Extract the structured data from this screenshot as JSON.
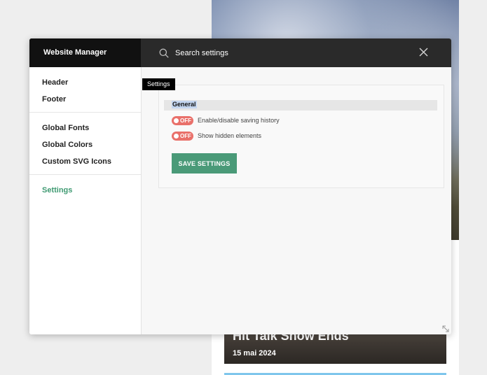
{
  "background": {
    "article_title": "Hit Talk Show Ends",
    "article_date": "15 mai 2024"
  },
  "header": {
    "app_title": "Website Manager",
    "search_placeholder": "Search settings",
    "search_value": "",
    "search_icon": "search-icon",
    "close_icon": "close-icon"
  },
  "sidebar": {
    "groups": [
      {
        "items": [
          {
            "label": "Header"
          },
          {
            "label": "Footer"
          }
        ]
      },
      {
        "items": [
          {
            "label": "Global Fonts"
          },
          {
            "label": "Global Colors"
          },
          {
            "label": "Custom SVG Icons"
          }
        ]
      },
      {
        "items": [
          {
            "label": "Settings",
            "active": true
          }
        ]
      }
    ]
  },
  "settings": {
    "panel_title": "Settings",
    "section_title": "General",
    "options": [
      {
        "label": "Enable/disable saving history",
        "state": "OFF"
      },
      {
        "label": "Show hidden elements",
        "state": "OFF"
      }
    ],
    "save_label": "SAVE SETTINGS"
  },
  "colors": {
    "accent": "#4a9a78",
    "active_link": "#3f9a72",
    "toggle_off": "#e9706a",
    "header_bg": "#2a2a2a",
    "brand_bg": "#111111"
  },
  "icons": {
    "resize": "resize-icon"
  }
}
